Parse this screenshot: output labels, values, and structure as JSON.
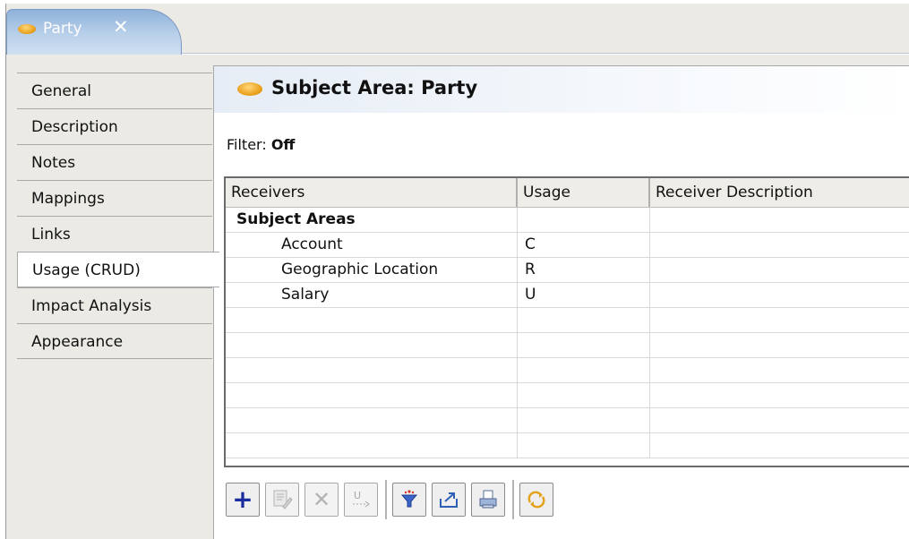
{
  "tab": {
    "label": "Party",
    "close": "✕"
  },
  "sidebar": {
    "items": [
      {
        "label": "General"
      },
      {
        "label": "Description"
      },
      {
        "label": "Notes"
      },
      {
        "label": "Mappings"
      },
      {
        "label": "Links"
      },
      {
        "label": "Usage (CRUD)",
        "active": true
      },
      {
        "label": "Impact Analysis"
      },
      {
        "label": "Appearance"
      }
    ]
  },
  "panel": {
    "title": "Subject Area: Party",
    "filter_label": "Filter:",
    "filter_value": "Off"
  },
  "grid": {
    "headers": [
      "Receivers",
      "Usage",
      "Receiver Description"
    ],
    "rows": [
      {
        "receiver": "Subject Areas",
        "usage": "",
        "description": ""
      },
      {
        "receiver": "Account",
        "usage": "C",
        "description": ""
      },
      {
        "receiver": "Geographic Location",
        "usage": "R",
        "description": ""
      },
      {
        "receiver": "Salary",
        "usage": "U",
        "description": ""
      }
    ]
  },
  "toolbar": {
    "buttons": [
      {
        "icon": "add-icon"
      },
      {
        "icon": "edit-icon"
      },
      {
        "icon": "delete-icon"
      },
      {
        "icon": "usage-icon"
      },
      {
        "icon": "filter-icon"
      },
      {
        "icon": "export-icon"
      },
      {
        "icon": "print-icon"
      },
      {
        "icon": "refresh-icon"
      }
    ]
  },
  "colors": {
    "tab_gradient_top": "#8fb1da",
    "oval_icon": "#e79a12",
    "add_icon": "#1a2d9e",
    "background": "#ebeae4"
  }
}
